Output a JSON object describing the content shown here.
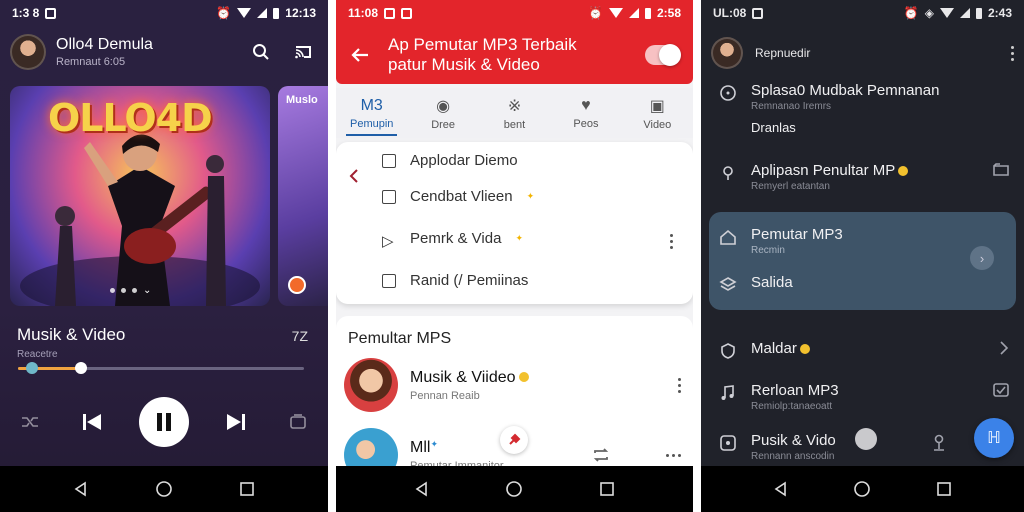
{
  "phone1": {
    "status": {
      "time": "1:3 8",
      "right_time": "12:13"
    },
    "header": {
      "title": "Ollo4 Demula",
      "subtitle": "Remnaut 6:05"
    },
    "album": {
      "logo": "OLLO4D",
      "side_label": "Muslo"
    },
    "track": {
      "title": "Musik & Video",
      "subtitle": "Reacetre",
      "duration": "7Z",
      "progress_pct": 22,
      "time_left": "",
      "time_right": ""
    },
    "colors": {
      "accent": "#f0a340",
      "bg": "#2a2140"
    },
    "icons": {
      "search": "search-icon",
      "cast": "cast-icon",
      "prev": "skip-previous-icon",
      "play": "pause-icon",
      "next": "skip-next-icon",
      "shuffle": "shuffle-icon",
      "queue": "queue-icon"
    }
  },
  "phone2": {
    "status": {
      "time": "11:08",
      "right_time": "2:58"
    },
    "appbar": {
      "title_line1": "Ap Pemutar MP3 Terbaik",
      "title_line2": "patur Musik & Video"
    },
    "tabs": [
      {
        "icon": "M3",
        "label": "Pemupin"
      },
      {
        "icon": "◉",
        "label": "Dree"
      },
      {
        "icon": "※",
        "label": "bent"
      },
      {
        "icon": "♥",
        "label": "Peos"
      },
      {
        "icon": "▣",
        "label": "Video"
      }
    ],
    "menu": [
      {
        "label": "Applodar Diemo"
      },
      {
        "label": "Cendbat Vlieen"
      },
      {
        "label": "Pemrk & Vida"
      },
      {
        "label": "Ranid (/ Pemiinas"
      }
    ],
    "list": {
      "header": "Pemultar MPS",
      "rows": [
        {
          "title": "Musik & Viideo",
          "subtitle": "Pennan Reaib"
        },
        {
          "title": "Mll",
          "subtitle": "Pemutar Immanitor"
        }
      ]
    },
    "colors": {
      "appbar": "#e3252b",
      "accent": "#1f5fa8"
    }
  },
  "phone3": {
    "status": {
      "time": "UL:08",
      "right_time": "2:43"
    },
    "header": {
      "name": "Repnuedir"
    },
    "items": [
      {
        "title": "Splasa0 Mudbak Pemnanan",
        "subtitle": "Remnanao Iremrs",
        "extra": "Dranlas"
      },
      {
        "title": "Aplipasn Penultar MP",
        "subtitle": "Remyerl eatantan"
      },
      {
        "title": "Pemutar MP3",
        "subtitle": "Recmin"
      },
      {
        "title": "Salida",
        "subtitle": ""
      },
      {
        "title": "Maldar",
        "subtitle": ""
      },
      {
        "title": "Rerloan MP3",
        "subtitle": "Remiolp:tanaeoatt"
      },
      {
        "title": "Pusik & Vido",
        "subtitle": "Rennann anscodin"
      }
    ],
    "colors": {
      "bg": "#20222a",
      "selected": "#3e5468",
      "fab": "#3b82e8"
    }
  }
}
